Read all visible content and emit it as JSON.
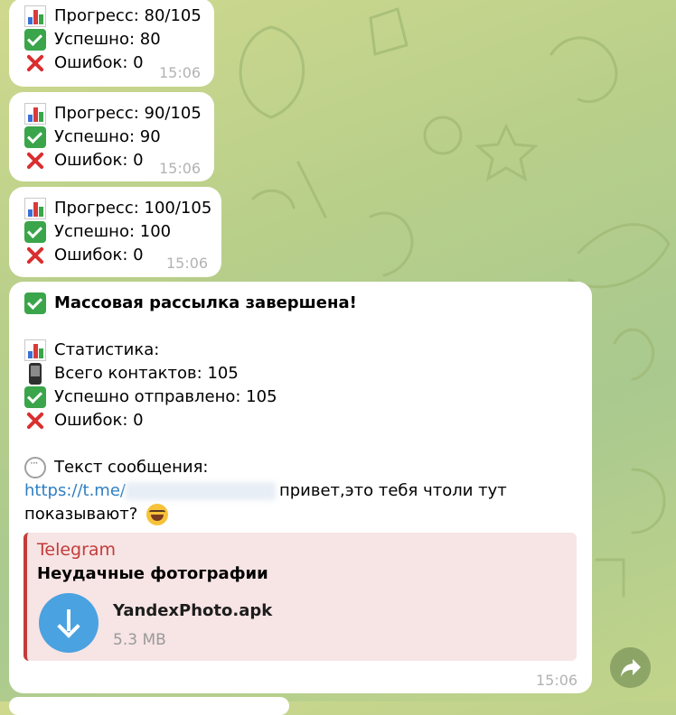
{
  "messages": [
    {
      "progress": "Прогресс: 80/105",
      "success": "Успешно: 80",
      "errors": "Ошибок: 0",
      "time": "15:06"
    },
    {
      "progress": "Прогресс: 90/105",
      "success": "Успешно: 90",
      "errors": "Ошибок: 0",
      "time": "15:06"
    },
    {
      "progress": "Прогресс: 100/105",
      "success": "Успешно: 100",
      "errors": "Ошибок: 0",
      "time": "15:06"
    }
  ],
  "final": {
    "heading": "Массовая рассылка завершена!",
    "stats_label": "Статистика:",
    "total": "Всего контактов: 105",
    "sent": "Успешно отправлено: 105",
    "errors": "Ошибок: 0",
    "text_label": "Текст сообщения:",
    "link": "https://t.me/",
    "msg_rest": "привет,это тебя чтоли тут",
    "msg_line2": "показывают?",
    "preview": {
      "site": "Telegram",
      "title": "Неудачные фотографии",
      "file_name": "YandexPhoto.apk",
      "file_size": "5.3 MB"
    },
    "time": "15:06"
  },
  "icons": {
    "chart": "bar-chart-icon",
    "check": "check-mark-button-icon",
    "cross": "cross-mark-icon",
    "phone": "mobile-phone-icon",
    "speech": "speech-balloon-icon",
    "laugh": "face-with-tears-of-joy-icon",
    "download": "download-icon",
    "forward": "forward-arrow-icon"
  }
}
